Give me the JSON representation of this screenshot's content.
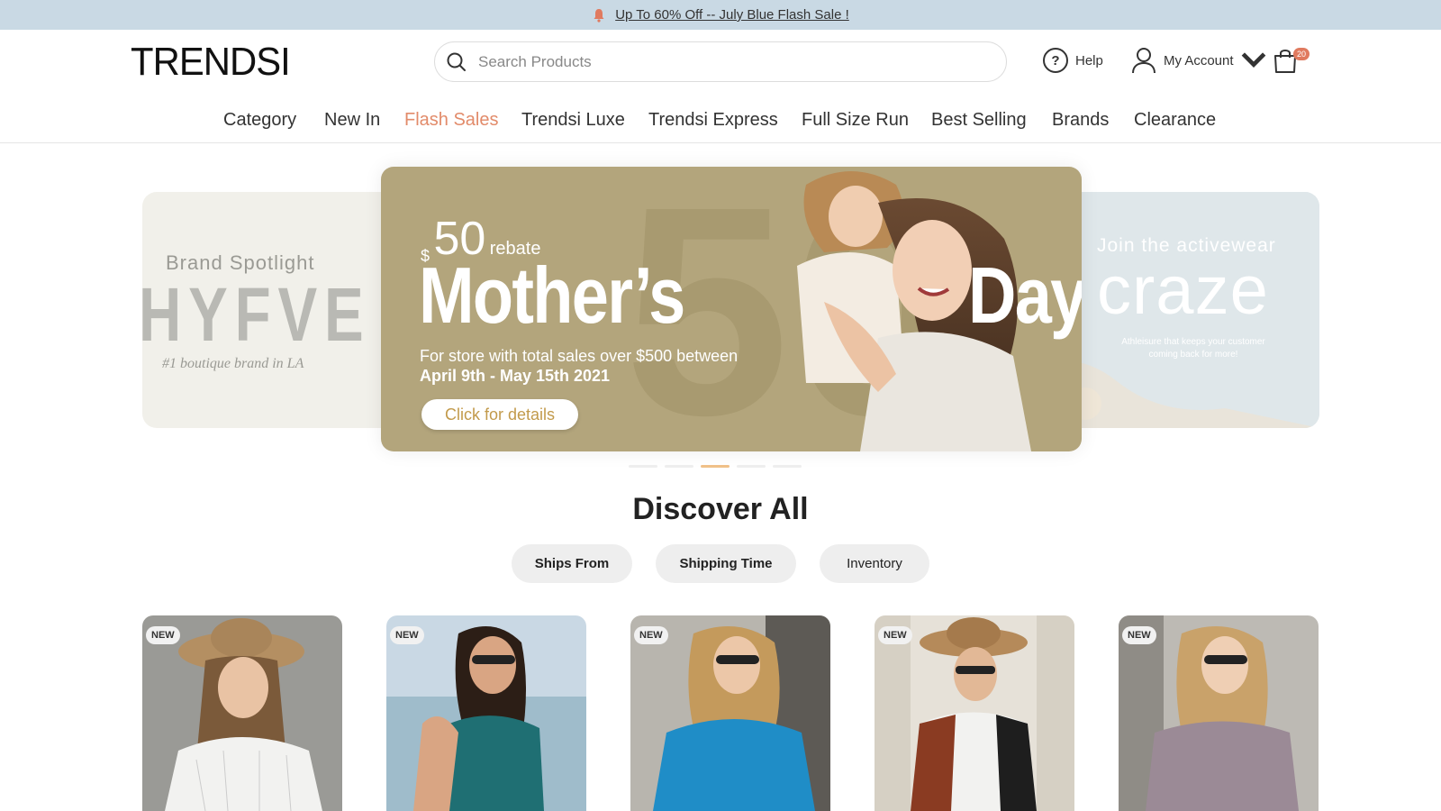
{
  "announcement": {
    "text": "Up To 60% Off -- July Blue Flash Sale !",
    "icon": "bell-icon"
  },
  "header": {
    "logo": "TRENDSI",
    "search_placeholder": "Search Products",
    "help_label": "Help",
    "account_label": "My Account",
    "cart_count": "20"
  },
  "nav": {
    "items": [
      "Category",
      "New In",
      "Flash Sales",
      "Trendsi Luxe",
      "Trendsi Express",
      "Full Size Run",
      "Best Selling",
      "Brands",
      "Clearance"
    ],
    "active": "Flash Sales",
    "active_color": "#e28b6a"
  },
  "carousel": {
    "left": {
      "kicker": "Brand Spotlight",
      "brand": "HYFVE",
      "tagline": "#1 boutique brand in LA"
    },
    "main": {
      "bg_number": "50",
      "rebate_dollar": "$",
      "rebate_amount": "50",
      "rebate_word": "rebate",
      "title_left": "Mother’s",
      "title_right": "Day",
      "line1": "For store with total sales over $500 between",
      "line2": "April 9th - May 15th 2021",
      "cta": "Click for details",
      "bg_color": "#b3a57c"
    },
    "right": {
      "kicker": "Join the activewear",
      "title": "craze",
      "sub": "Athleisure that keeps your customer coming back for more!"
    },
    "dots": 5,
    "active_dot": 2
  },
  "discover": {
    "title": "Discover All",
    "filters": [
      "Ships From",
      "Shipping Time",
      "Inventory"
    ]
  },
  "products": [
    {
      "badge": "NEW"
    },
    {
      "badge": "NEW"
    },
    {
      "badge": "NEW"
    },
    {
      "badge": "NEW"
    },
    {
      "badge": "NEW"
    }
  ]
}
